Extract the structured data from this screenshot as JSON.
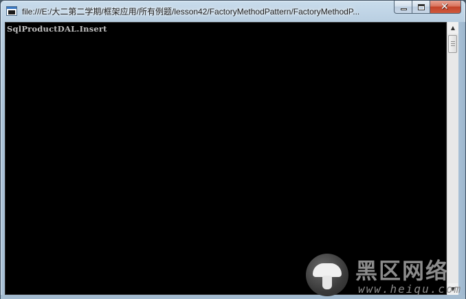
{
  "window": {
    "title": "file:///E:/大二第二学期/框架应用/所有例题/lesson42/FactoryMethodPattern/FactoryMethodP...",
    "app_icon": "console-app-icon",
    "buttons": {
      "minimize_icon": "minimize-icon",
      "maximize_icon": "maximize-icon",
      "close_glyph": "✕"
    }
  },
  "console": {
    "lines": [
      "SqlProductDAL.Insert"
    ],
    "background": "#000000",
    "text_color": "#c0c0c0"
  },
  "scrollbar": {
    "up_arrow": "▲",
    "down_arrow": "▼"
  },
  "watermark": {
    "brand": "黑区网络",
    "url": "www.heiqu.com",
    "logo_icon": "mushroom-icon"
  }
}
